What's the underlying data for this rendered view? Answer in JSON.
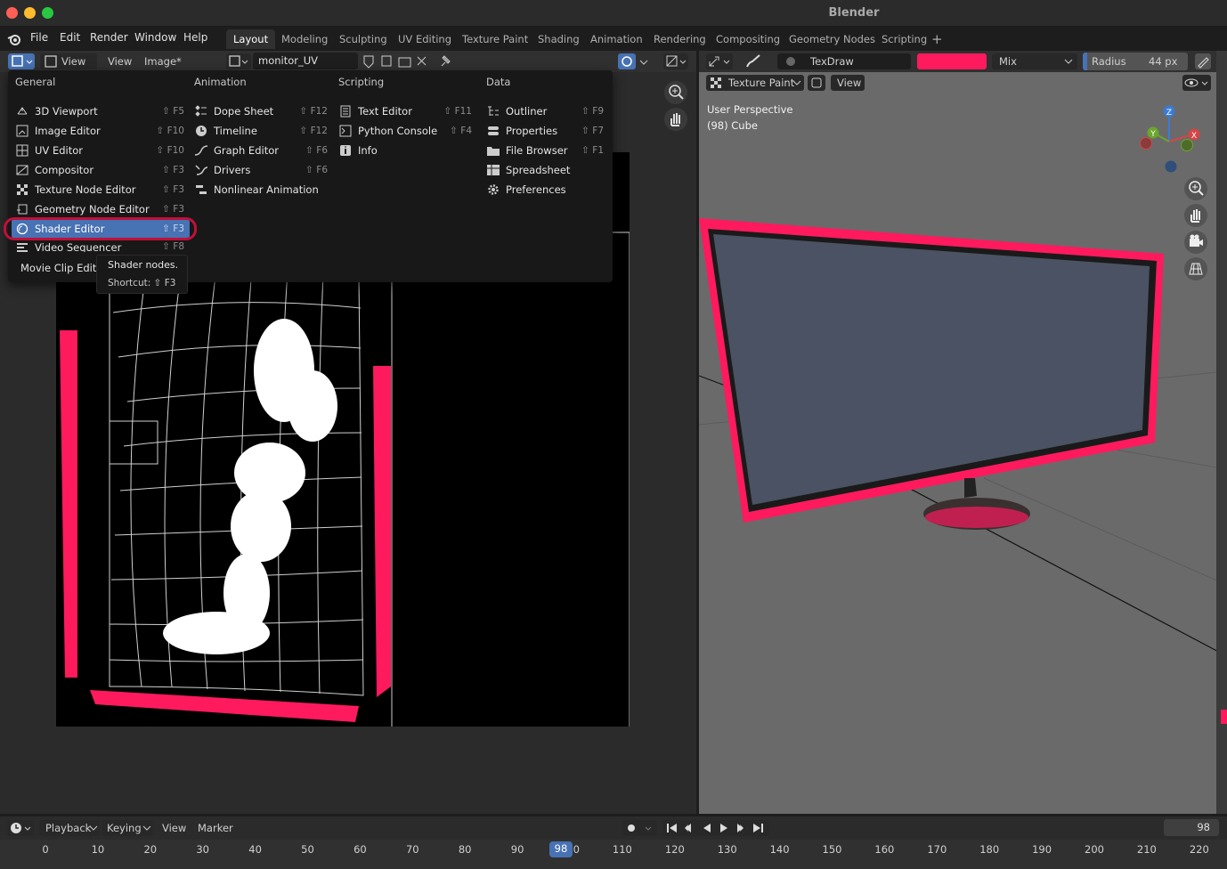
{
  "app": {
    "title": "Blender"
  },
  "menubar": {
    "items": [
      "File",
      "Edit",
      "Render",
      "Window",
      "Help"
    ],
    "workspaces": [
      "Layout",
      "Modeling",
      "Sculpting",
      "UV Editing",
      "Texture Paint",
      "Shading",
      "Animation",
      "Rendering",
      "Compositing",
      "Geometry Nodes",
      "Scripting"
    ],
    "active_workspace": "Layout"
  },
  "image_editor": {
    "header": {
      "view_label": "View",
      "view2_label": "View",
      "image_label": "Image*",
      "image_name": "monitor_UV"
    }
  },
  "editor_menu": {
    "columns": [
      {
        "heading": "General",
        "items": [
          {
            "label": "3D Viewport",
            "shortcut": "⇧ F5",
            "icon": "cube-icon"
          },
          {
            "label": "Image Editor",
            "shortcut": "⇧ F10",
            "icon": "image-icon"
          },
          {
            "label": "UV Editor",
            "shortcut": "⇧ F10",
            "icon": "uv-icon"
          },
          {
            "label": "Compositor",
            "shortcut": "⇧ F3",
            "icon": "compositor-icon"
          },
          {
            "label": "Texture Node Editor",
            "shortcut": "⇧ F3",
            "icon": "texture-icon"
          },
          {
            "label": "Geometry Node Editor",
            "shortcut": "⇧ F3",
            "icon": "geometry-nodes-icon"
          },
          {
            "label": "Shader Editor",
            "shortcut": "⇧ F3",
            "icon": "shader-icon"
          },
          {
            "label": "Video Sequencer",
            "shortcut": "⇧ F8",
            "icon": "sequencer-icon"
          },
          {
            "label": "Movie Clip Editor",
            "shortcut": "",
            "icon": "tracker-icon"
          }
        ]
      },
      {
        "heading": "Animation",
        "items": [
          {
            "label": "Dope Sheet",
            "shortcut": "⇧ F12",
            "icon": "dopesheet-icon"
          },
          {
            "label": "Timeline",
            "shortcut": "⇧ F12",
            "icon": "clock-icon"
          },
          {
            "label": "Graph Editor",
            "shortcut": "⇧ F6",
            "icon": "graph-icon"
          },
          {
            "label": "Drivers",
            "shortcut": "⇧ F6",
            "icon": "driver-icon"
          },
          {
            "label": "Nonlinear Animation",
            "shortcut": "",
            "icon": "nla-icon"
          }
        ]
      },
      {
        "heading": "Scripting",
        "items": [
          {
            "label": "Text Editor",
            "shortcut": "⇧ F11",
            "icon": "text-icon"
          },
          {
            "label": "Python Console",
            "shortcut": "⇧ F4",
            "icon": "console-icon"
          },
          {
            "label": "Info",
            "shortcut": "",
            "icon": "info-icon"
          }
        ]
      },
      {
        "heading": "Data",
        "items": [
          {
            "label": "Outliner",
            "shortcut": "⇧ F9",
            "icon": "outliner-icon"
          },
          {
            "label": "Properties",
            "shortcut": "⇧ F7",
            "icon": "properties-icon"
          },
          {
            "label": "File Browser",
            "shortcut": "⇧ F1",
            "icon": "folder-icon"
          },
          {
            "label": "Spreadsheet",
            "shortcut": "",
            "icon": "spreadsheet-icon"
          },
          {
            "label": "Preferences",
            "shortcut": "",
            "icon": "gear-icon"
          }
        ]
      }
    ],
    "tooltip": {
      "text": "Shader nodes.",
      "shortcut": "Shortcut: ⇧ F3"
    }
  },
  "viewport": {
    "tool_name": "TexDraw",
    "blend_mode": "Mix",
    "radius_label": "Radius",
    "radius_value": "44 px",
    "mode": "Texture Paint",
    "view_label": "View",
    "perspective": "User Perspective",
    "object": "(98) Cube",
    "brush_color": "#ff1a5e",
    "gizmo": {
      "x": "X",
      "y": "Y",
      "z": "Z"
    }
  },
  "timeline": {
    "playback": "Playback",
    "keying": "Keying",
    "view": "View",
    "marker": "Marker",
    "current_frame": "98",
    "ticks": [
      "0",
      "10",
      "20",
      "30",
      "40",
      "50",
      "60",
      "70",
      "80",
      "90",
      "100",
      "110",
      "120",
      "130",
      "140",
      "150",
      "160",
      "170",
      "180",
      "190",
      "200",
      "210",
      "220"
    ]
  }
}
